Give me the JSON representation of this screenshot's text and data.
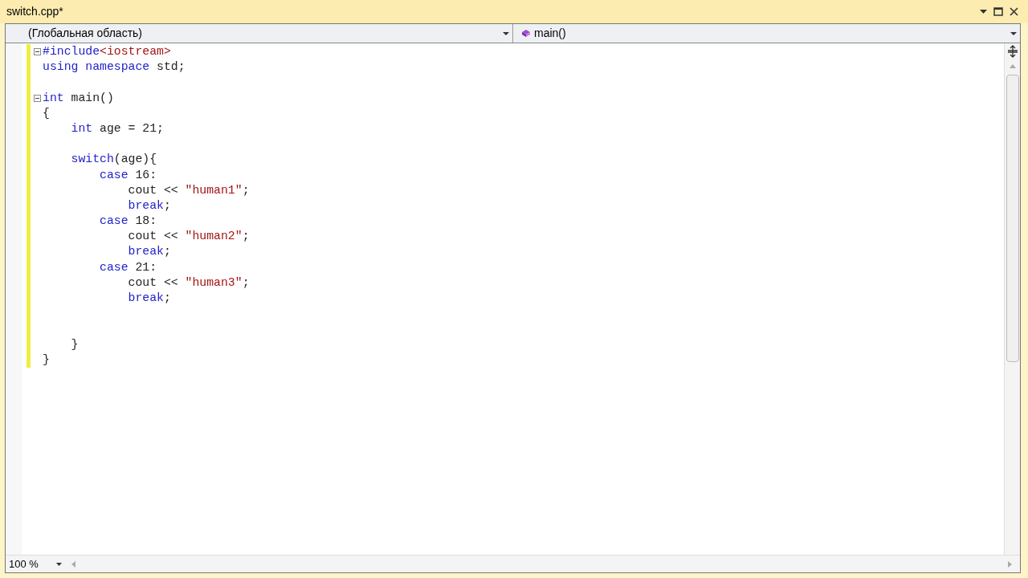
{
  "window": {
    "title": "switch.cpp*"
  },
  "scope_bar": {
    "scope": "(Глобальная область)",
    "member": "main()"
  },
  "editor": {
    "lines": [
      {
        "kind": "code",
        "fold": true,
        "tokens": [
          {
            "kind": "preproc",
            "text": "#include"
          },
          {
            "kind": "string",
            "text": "<iostream>"
          }
        ]
      },
      {
        "kind": "code",
        "fold": false,
        "tokens": [
          {
            "kind": "keyword",
            "text": "using"
          },
          {
            "kind": "keyword",
            "text": " namespace"
          },
          {
            "kind": "plain",
            "text": " std;"
          }
        ]
      },
      {
        "kind": "blank"
      },
      {
        "kind": "code",
        "fold": true,
        "tokens": [
          {
            "kind": "keyword",
            "text": "int"
          },
          {
            "kind": "plain",
            "text": " main()"
          }
        ]
      },
      {
        "kind": "code",
        "fold": false,
        "tokens": [
          {
            "kind": "plain",
            "text": "{"
          }
        ]
      },
      {
        "kind": "code",
        "fold": false,
        "tokens": [
          {
            "kind": "keyword",
            "text": "    int"
          },
          {
            "kind": "plain",
            "text": " age = 21;"
          }
        ]
      },
      {
        "kind": "blank"
      },
      {
        "kind": "code",
        "fold": false,
        "tokens": [
          {
            "kind": "keyword",
            "text": "    switch"
          },
          {
            "kind": "plain",
            "text": "(age){"
          }
        ]
      },
      {
        "kind": "code",
        "fold": false,
        "tokens": [
          {
            "kind": "keyword",
            "text": "        case"
          },
          {
            "kind": "plain",
            "text": " 16:"
          }
        ]
      },
      {
        "kind": "code",
        "fold": false,
        "tokens": [
          {
            "kind": "plain",
            "text": "            cout << "
          },
          {
            "kind": "string",
            "text": "\"human1\""
          },
          {
            "kind": "plain",
            "text": ";"
          }
        ]
      },
      {
        "kind": "code",
        "fold": false,
        "tokens": [
          {
            "kind": "keyword",
            "text": "            break"
          },
          {
            "kind": "plain",
            "text": ";"
          }
        ]
      },
      {
        "kind": "code",
        "fold": false,
        "tokens": [
          {
            "kind": "keyword",
            "text": "        case"
          },
          {
            "kind": "plain",
            "text": " 18:"
          }
        ]
      },
      {
        "kind": "code",
        "fold": false,
        "tokens": [
          {
            "kind": "plain",
            "text": "            cout << "
          },
          {
            "kind": "string",
            "text": "\"human2\""
          },
          {
            "kind": "plain",
            "text": ";"
          }
        ]
      },
      {
        "kind": "code",
        "fold": false,
        "tokens": [
          {
            "kind": "keyword",
            "text": "            break"
          },
          {
            "kind": "plain",
            "text": ";"
          }
        ]
      },
      {
        "kind": "code",
        "fold": false,
        "tokens": [
          {
            "kind": "keyword",
            "text": "        case"
          },
          {
            "kind": "plain",
            "text": " 21:"
          }
        ]
      },
      {
        "kind": "code",
        "fold": false,
        "tokens": [
          {
            "kind": "plain",
            "text": "            cout << "
          },
          {
            "kind": "string",
            "text": "\"human3\""
          },
          {
            "kind": "plain",
            "text": ";"
          }
        ]
      },
      {
        "kind": "code",
        "fold": false,
        "tokens": [
          {
            "kind": "keyword",
            "text": "            break"
          },
          {
            "kind": "plain",
            "text": ";"
          }
        ]
      },
      {
        "kind": "blank"
      },
      {
        "kind": "blank"
      },
      {
        "kind": "code",
        "fold": false,
        "tokens": [
          {
            "kind": "plain",
            "text": "    }"
          }
        ]
      },
      {
        "kind": "code",
        "fold": false,
        "tokens": [
          {
            "kind": "plain",
            "text": "}"
          }
        ]
      }
    ]
  },
  "status": {
    "zoom": "100 %"
  }
}
